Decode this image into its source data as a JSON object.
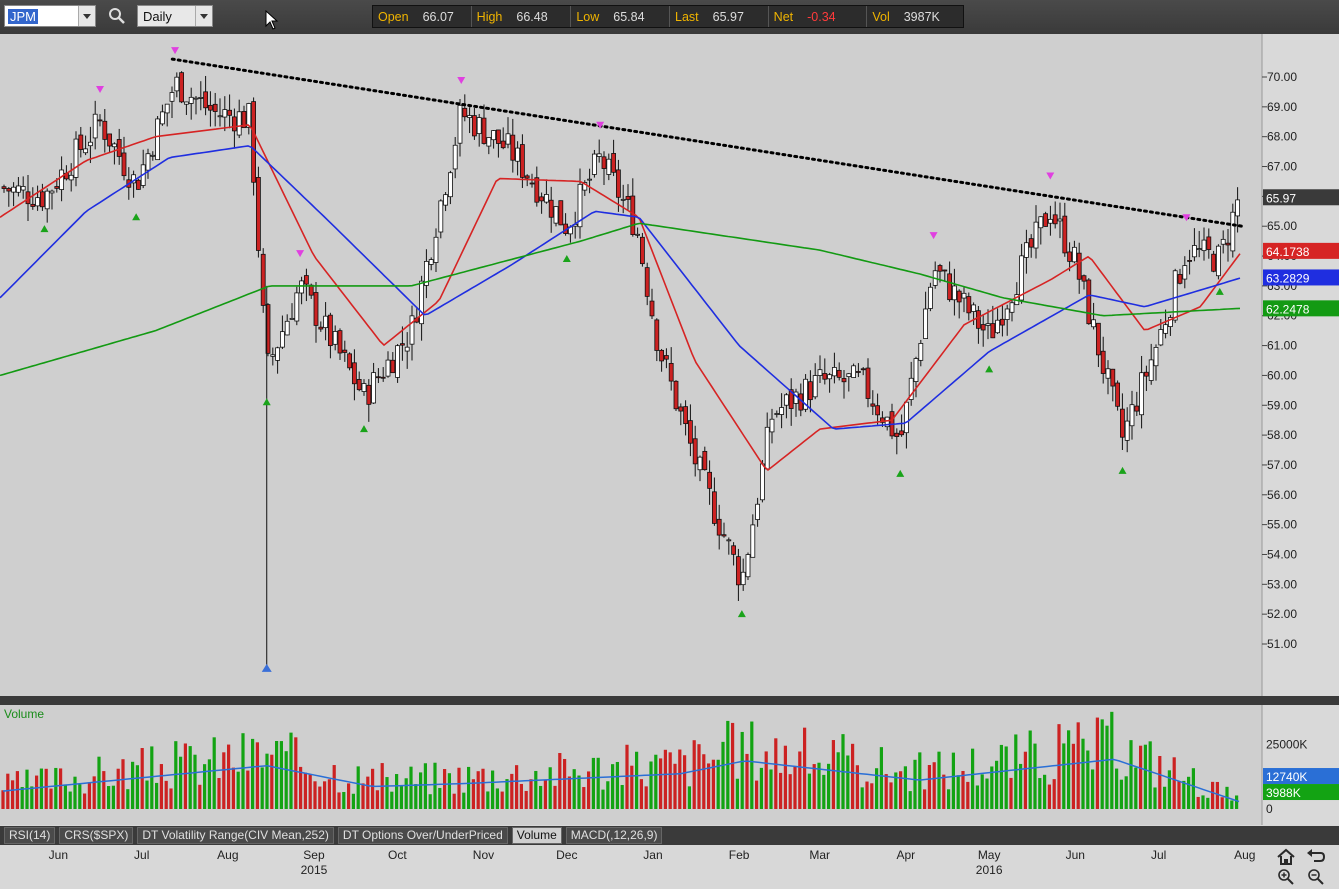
{
  "toolbar": {
    "symbol": "JPM",
    "period": "Daily",
    "quote": [
      {
        "label": "Open",
        "value": "66.07"
      },
      {
        "label": "High",
        "value": "66.48"
      },
      {
        "label": "Low",
        "value": "65.84"
      },
      {
        "label": "Last",
        "value": "65.97"
      },
      {
        "label": "Net",
        "value": "-0.34"
      },
      {
        "label": "Vol",
        "value": "3987K"
      }
    ]
  },
  "indicator_tabs": [
    "RSI(14)",
    "CRS($SPX)",
    "DT Volatility Range(CIV Mean,252)",
    "DT Options Over/UnderPriced",
    "Volume",
    "MACD(,12,26,9)"
  ],
  "active_tab": "Volume",
  "colors": {
    "up": "#13a313",
    "down": "#cc2222",
    "ma_fast": "#d62424",
    "ma_mid": "#1f2ee0",
    "ma_slow": "#139a13",
    "last_badge": "#3a3a3a",
    "trendline": "#000000",
    "pivot_high": "#e040e0",
    "pivot_low": "#1aa31a",
    "pivot_extreme": "#3a6fd8",
    "vol_avg": "#2a6fd6"
  },
  "chart_data": [
    {
      "type": "candlestick",
      "title": "",
      "ylim": [
        50.0,
        71.0
      ],
      "y_ticks": [
        "70.00",
        "69.00",
        "68.00",
        "67.00",
        "66.00",
        "65.00",
        "64.00",
        "63.00",
        "62.00",
        "61.00",
        "60.00",
        "59.00",
        "58.00",
        "57.00",
        "56.00",
        "55.00",
        "54.00",
        "53.00",
        "52.00",
        "51.00"
      ],
      "grid": false,
      "x_labels": [
        {
          "label": "Jun",
          "date": "2015-06"
        },
        {
          "label": "Jul",
          "date": "2015-07"
        },
        {
          "label": "Aug",
          "date": "2015-08"
        },
        {
          "label": "Sep",
          "date": "2015-09"
        },
        {
          "label": "Oct",
          "date": "2015-10"
        },
        {
          "label": "Nov",
          "date": "2015-11"
        },
        {
          "label": "Dec",
          "date": "2015-12"
        },
        {
          "label": "Jan",
          "date": "2016-01"
        },
        {
          "label": "Feb",
          "date": "2016-02"
        },
        {
          "label": "Mar",
          "date": "2016-03"
        },
        {
          "label": "Apr",
          "date": "2016-04"
        },
        {
          "label": "May",
          "date": "2016-05"
        },
        {
          "label": "Jun",
          "date": "2016-06"
        },
        {
          "label": "Jul",
          "date": "2016-07"
        },
        {
          "label": "Aug",
          "date": "2016-08"
        }
      ],
      "year_labels": [
        {
          "label": "2015",
          "date": "2015-09"
        },
        {
          "label": "2016",
          "date": "2016-05"
        }
      ],
      "price_path": [
        {
          "date": "2015-05-20",
          "close": 66.3
        },
        {
          "date": "2015-06-05",
          "close": 66.0
        },
        {
          "date": "2015-06-25",
          "close": 68.5
        },
        {
          "date": "2015-07-08",
          "close": 66.4
        },
        {
          "date": "2015-07-22",
          "close": 69.8
        },
        {
          "date": "2015-08-05",
          "close": 68.8
        },
        {
          "date": "2015-08-18",
          "close": 68.6
        },
        {
          "date": "2015-08-24",
          "close": 60.2
        },
        {
          "date": "2015-09-05",
          "close": 63.0
        },
        {
          "date": "2015-09-28",
          "close": 59.3
        },
        {
          "date": "2015-10-15",
          "close": 61.5
        },
        {
          "date": "2015-11-02",
          "close": 68.8
        },
        {
          "date": "2015-11-20",
          "close": 67.5
        },
        {
          "date": "2015-12-10",
          "close": 65.0
        },
        {
          "date": "2015-12-22",
          "close": 67.3
        },
        {
          "date": "2016-01-04",
          "close": 65.0
        },
        {
          "date": "2016-01-12",
          "close": 61.0
        },
        {
          "date": "2016-01-25",
          "close": 57.2
        },
        {
          "date": "2016-02-11",
          "close": 53.1
        },
        {
          "date": "2016-02-22",
          "close": 58.7
        },
        {
          "date": "2016-03-10",
          "close": 59.8
        },
        {
          "date": "2016-03-25",
          "close": 59.8
        },
        {
          "date": "2016-04-08",
          "close": 57.8
        },
        {
          "date": "2016-04-20",
          "close": 63.6
        },
        {
          "date": "2016-05-10",
          "close": 61.3
        },
        {
          "date": "2016-06-01",
          "close": 65.6
        },
        {
          "date": "2016-06-10",
          "close": 63.8
        },
        {
          "date": "2016-06-27",
          "close": 57.9
        },
        {
          "date": "2016-07-10",
          "close": 61.2
        },
        {
          "date": "2016-07-20",
          "close": 64.2
        },
        {
          "date": "2016-08-01",
          "close": 63.9
        },
        {
          "date": "2016-08-08",
          "close": 65.97
        }
      ],
      "spike_low": {
        "date": "2015-08-24",
        "low": 50.1
      },
      "trendline": {
        "start": {
          "date": "2015-07-21",
          "price": 70.6
        },
        "end": {
          "date": "2016-08-09",
          "price": 65.0
        }
      },
      "moving_averages": [
        {
          "period": "fast",
          "last": "64.1738",
          "path": [
            {
              "date": "2015-05-20",
              "v": 65.3
            },
            {
              "date": "2015-06-20",
              "v": 67.2
            },
            {
              "date": "2015-07-15",
              "v": 68.0
            },
            {
              "date": "2015-08-18",
              "v": 68.4
            },
            {
              "date": "2015-09-10",
              "v": 64.0
            },
            {
              "date": "2015-10-05",
              "v": 61.0
            },
            {
              "date": "2015-10-25",
              "v": 62.5
            },
            {
              "date": "2015-11-15",
              "v": 66.6
            },
            {
              "date": "2015-12-15",
              "v": 66.5
            },
            {
              "date": "2016-01-05",
              "v": 65.3
            },
            {
              "date": "2016-01-25",
              "v": 60.5
            },
            {
              "date": "2016-02-20",
              "v": 56.8
            },
            {
              "date": "2016-03-10",
              "v": 58.2
            },
            {
              "date": "2016-04-05",
              "v": 58.5
            },
            {
              "date": "2016-05-01",
              "v": 61.7
            },
            {
              "date": "2016-06-01",
              "v": 63.2
            },
            {
              "date": "2016-06-15",
              "v": 64.0
            },
            {
              "date": "2016-07-05",
              "v": 61.5
            },
            {
              "date": "2016-07-25",
              "v": 62.3
            },
            {
              "date": "2016-08-09",
              "v": 64.17
            }
          ]
        },
        {
          "period": "mid",
          "last": "63.2829",
          "path": [
            {
              "date": "2015-05-20",
              "v": 62.6
            },
            {
              "date": "2015-06-20",
              "v": 65.5
            },
            {
              "date": "2015-07-20",
              "v": 67.3
            },
            {
              "date": "2015-08-18",
              "v": 67.7
            },
            {
              "date": "2015-09-15",
              "v": 65.2
            },
            {
              "date": "2015-10-20",
              "v": 62.0
            },
            {
              "date": "2015-11-20",
              "v": 63.7
            },
            {
              "date": "2015-12-20",
              "v": 65.5
            },
            {
              "date": "2016-01-05",
              "v": 65.3
            },
            {
              "date": "2016-02-10",
              "v": 61.0
            },
            {
              "date": "2016-03-15",
              "v": 58.2
            },
            {
              "date": "2016-04-10",
              "v": 58.4
            },
            {
              "date": "2016-05-10",
              "v": 60.8
            },
            {
              "date": "2016-06-15",
              "v": 62.7
            },
            {
              "date": "2016-07-05",
              "v": 62.3
            },
            {
              "date": "2016-08-09",
              "v": 63.28
            }
          ]
        },
        {
          "period": "slow",
          "last": "62.2478",
          "path": [
            {
              "date": "2015-05-20",
              "v": 60.0
            },
            {
              "date": "2015-07-15",
              "v": 61.5
            },
            {
              "date": "2015-08-25",
              "v": 63.0
            },
            {
              "date": "2015-10-15",
              "v": 63.0
            },
            {
              "date": "2015-12-15",
              "v": 64.5
            },
            {
              "date": "2016-01-05",
              "v": 65.1
            },
            {
              "date": "2016-03-10",
              "v": 64.2
            },
            {
              "date": "2016-04-15",
              "v": 63.4
            },
            {
              "date": "2016-05-15",
              "v": 62.6
            },
            {
              "date": "2016-06-20",
              "v": 62.0
            },
            {
              "date": "2016-08-09",
              "v": 62.25
            }
          ]
        }
      ],
      "last_price": "65.97"
    },
    {
      "type": "bar",
      "title": "Volume",
      "y_ticks": [
        "25000K",
        "0"
      ],
      "avg_volume": "12740K",
      "last_volume": "3988K",
      "volume_path": [
        {
          "date": "2015-05-20",
          "v": 11000
        },
        {
          "date": "2015-08-24",
          "v": 27000
        },
        {
          "date": "2015-10-01",
          "v": 14000
        },
        {
          "date": "2015-11-05",
          "v": 16000
        },
        {
          "date": "2016-01-20",
          "v": 22000
        },
        {
          "date": "2016-02-12",
          "v": 30000
        },
        {
          "date": "2016-04-15",
          "v": 18000
        },
        {
          "date": "2016-06-24",
          "v": 31000
        },
        {
          "date": "2016-08-09",
          "v": 3988
        }
      ]
    }
  ]
}
